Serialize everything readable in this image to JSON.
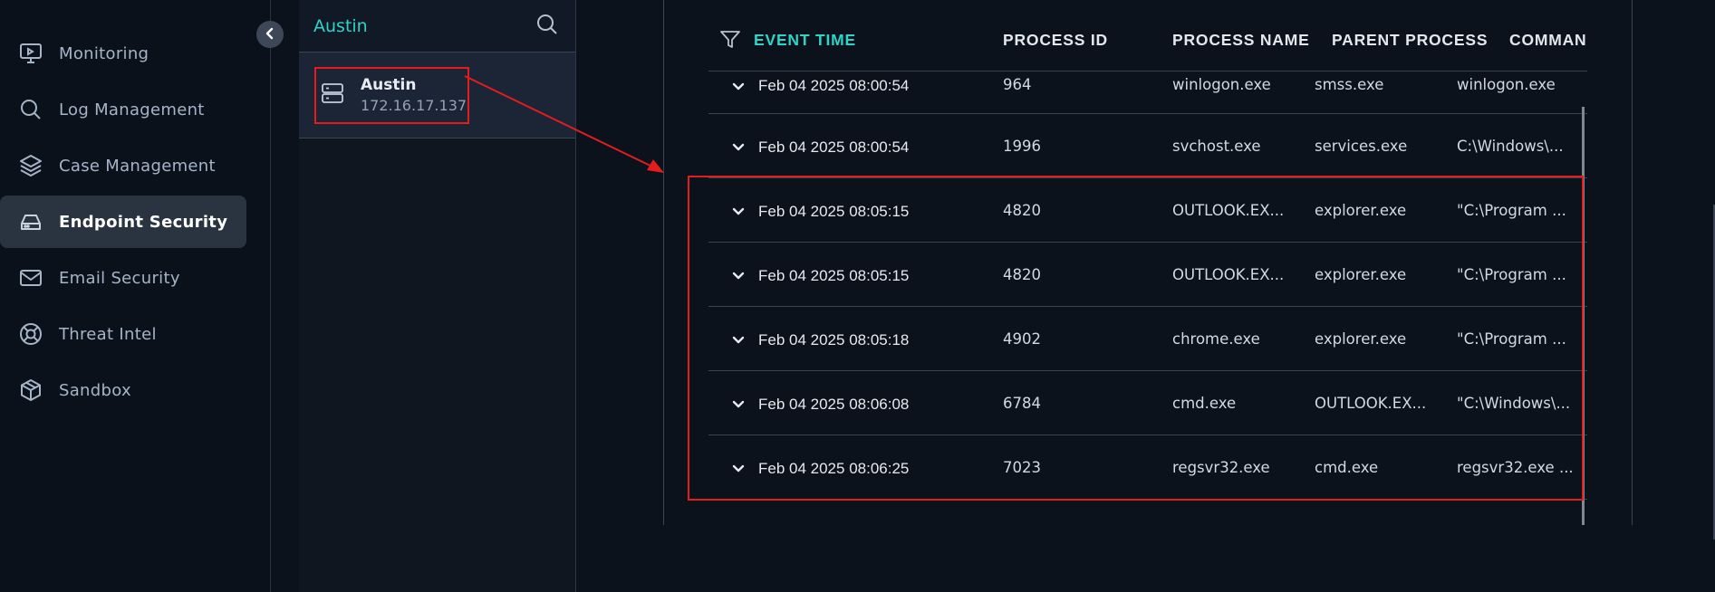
{
  "sidebar": {
    "items": [
      {
        "label": "Monitoring",
        "icon": "monitor-icon"
      },
      {
        "label": "Log Management",
        "icon": "search-icon"
      },
      {
        "label": "Case Management",
        "icon": "layers-icon"
      },
      {
        "label": "Endpoint Security",
        "icon": "hard-drive-icon",
        "active": true
      },
      {
        "label": "Email Security",
        "icon": "mail-icon"
      },
      {
        "label": "Threat Intel",
        "icon": "lifebuoy-icon"
      },
      {
        "label": "Sandbox",
        "icon": "cube-icon"
      }
    ]
  },
  "host_panel": {
    "search_value": "Austin",
    "host": {
      "name": "Austin",
      "ip": "172.16.17.137",
      "icon": "server-icon"
    }
  },
  "table": {
    "columns": [
      "EVENT TIME",
      "PROCESS ID",
      "PROCESS NAME",
      "PARENT PROCESS",
      "COMMAN"
    ],
    "rows": [
      {
        "time": "Feb 04 2025 08:00:54",
        "pid": "964",
        "name": "winlogon.exe",
        "parent": "smss.exe",
        "cmd": "winlogon.exe"
      },
      {
        "time": "Feb 04 2025 08:00:54",
        "pid": "1996",
        "name": "svchost.exe",
        "parent": "services.exe",
        "cmd": "C:\\Windows\\..."
      },
      {
        "time": "Feb 04 2025 08:05:15",
        "pid": "4820",
        "name": "OUTLOOK.EX...",
        "parent": "explorer.exe",
        "cmd": "\"C:\\Program ..."
      },
      {
        "time": "Feb 04 2025 08:05:15",
        "pid": "4820",
        "name": "OUTLOOK.EX...",
        "parent": "explorer.exe",
        "cmd": "\"C:\\Program ..."
      },
      {
        "time": "Feb 04 2025 08:05:18",
        "pid": "4902",
        "name": "chrome.exe",
        "parent": "explorer.exe",
        "cmd": "\"C:\\Program ..."
      },
      {
        "time": "Feb 04 2025 08:06:08",
        "pid": "6784",
        "name": "cmd.exe",
        "parent": "OUTLOOK.EX...",
        "cmd": "\"C:\\Windows\\..."
      },
      {
        "time": "Feb 04 2025 08:06:25",
        "pid": "7023",
        "name": "regsvr32.exe",
        "parent": "cmd.exe",
        "cmd": "regsvr32.exe ..."
      }
    ]
  },
  "colors": {
    "accent": "#2dd4c7",
    "highlight": "#e11d1d",
    "active_nav": "#2a3440"
  }
}
